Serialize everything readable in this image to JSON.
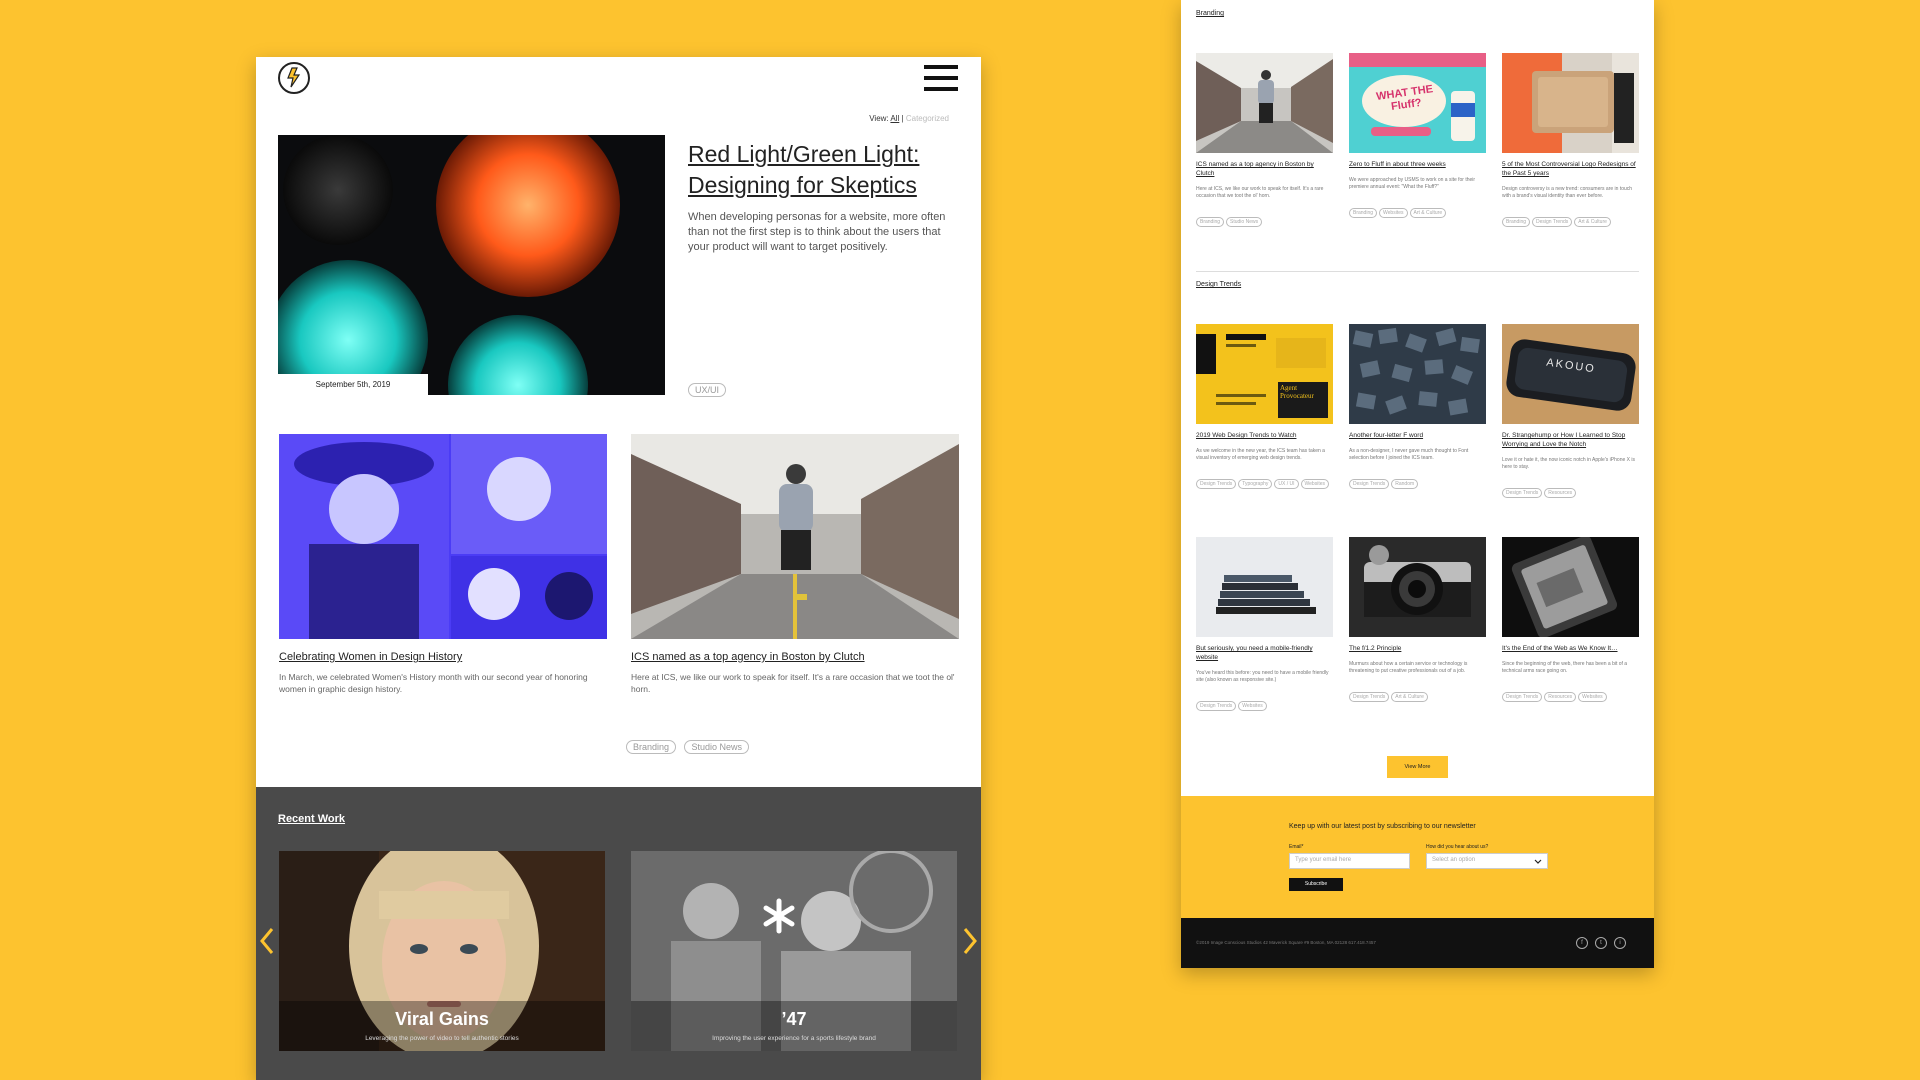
{
  "left": {
    "view": {
      "label": "View:",
      "all": "All",
      "separator": "|",
      "categorized": "Categorized"
    },
    "hero": {
      "title": "Red Light/Green Light: Designing for Skeptics",
      "excerpt": "When developing personas for a website, more often than not the first step is to think about the users that your product will want to target positively.",
      "date": "September 5th, 2019",
      "tag": "UX/UI"
    },
    "posts": [
      {
        "title": "Celebrating Women in Design History",
        "excerpt": "In March, we celebrated Women's History month with our second year of honoring women in graphic design history."
      },
      {
        "title": "ICS named as a top agency in Boston by Clutch",
        "excerpt": "Here at ICS, we like our work to speak for itself. It's a rare occasion that we toot the ol' horn."
      }
    ],
    "post_tags": [
      "Branding",
      "Studio News"
    ],
    "recent_work": {
      "title": "Recent Work",
      "items": [
        {
          "name": "Viral Gains",
          "desc": "Leveraging the power of video to tell authentic stories"
        },
        {
          "name": "’47",
          "desc": "Improving the user experience for a sports lifestyle brand"
        }
      ]
    }
  },
  "right": {
    "sections": [
      {
        "title": "Branding",
        "cards": [
          {
            "title": "ICS named as a top agency in Boston by Clutch",
            "excerpt": "Here at ICS, we like our work to speak for itself. It's a rare occasion that we toot the ol' horn.",
            "tags": [
              "Branding",
              "Studio News"
            ]
          },
          {
            "title": "Zero to Fluff in about three weeks",
            "excerpt": "We were approached by USMS to work on a site for their premiere annual event: \"What the Fluff?\"",
            "tags": [
              "Branding",
              "Websites",
              "Art & Culture"
            ]
          },
          {
            "title": "5 of the Most Controversial Logo Redesigns of the Past 5 years",
            "excerpt": "Design controversy is a new trend: consumers are in touch with a brand's visual identity than ever before.",
            "tags": [
              "Branding",
              "Design Trends",
              "Art & Culture"
            ]
          }
        ]
      },
      {
        "title": "Design Trends",
        "cards": [
          {
            "title": "2019 Web Design Trends to Watch",
            "excerpt": "As we welcome in the new year, the ICS team has taken a visual inventory of emerging web design trends.",
            "tags": [
              "Design Trends",
              "Typography",
              "UX / UI",
              "Websites"
            ]
          },
          {
            "title": "Another four-letter F word",
            "excerpt": "As a non-designer, I never gave much thought to Font selection before I joined the ICS team.",
            "tags": [
              "Design Trends",
              "Random"
            ]
          },
          {
            "title": "Dr. Strangehump or How I Learned to Stop Worrying and Love the Notch",
            "excerpt": "Love it or hate it, the now iconic notch in Apple's iPhone X is here to stay.",
            "tags": [
              "Design Trends",
              "Resources"
            ]
          },
          {
            "title": "But seriously, you need a mobile-friendly website",
            "excerpt": "You've heard this before: you need to have a mobile friendly site (also known as responsive site.)",
            "tags": [
              "Design Trends",
              "Websites"
            ]
          },
          {
            "title": "The f/1.2 Principle",
            "excerpt": "Murmurs about how a certain service or technology is threatening to put creative professionals out of a job.",
            "tags": [
              "Design Trends",
              "Art & Culture"
            ]
          },
          {
            "title": "It's the End of the Web as We Know It…",
            "excerpt": "Since the beginning of the web, there has been a bit of a technical arms race going on.",
            "tags": [
              "Design Trends",
              "Resources",
              "Websites"
            ]
          }
        ]
      }
    ],
    "fluff_art_text": "WHAT THE Fluff?",
    "akoud_text": "AKOUO",
    "trends_poster_text": "Agent Provocateur",
    "view_more": "View More",
    "newsletter": {
      "title": "Keep up with our latest post by subscribing to our newsletter",
      "email_label": "Email*",
      "email_placeholder": "Type your email here",
      "source_label": "How did you hear about us?",
      "source_placeholder": "Select an option",
      "button": "Subscribe"
    },
    "footer": {
      "text": "©2019 Image Conscious Studios 42 Maverick Square #9 Boston, MA 02128 617.418.7457",
      "social": [
        "f",
        "t",
        "i"
      ]
    }
  },
  "colors": {
    "background": "#FDC32F",
    "dark_band": "#4a4a4a",
    "footer": "#111111"
  }
}
